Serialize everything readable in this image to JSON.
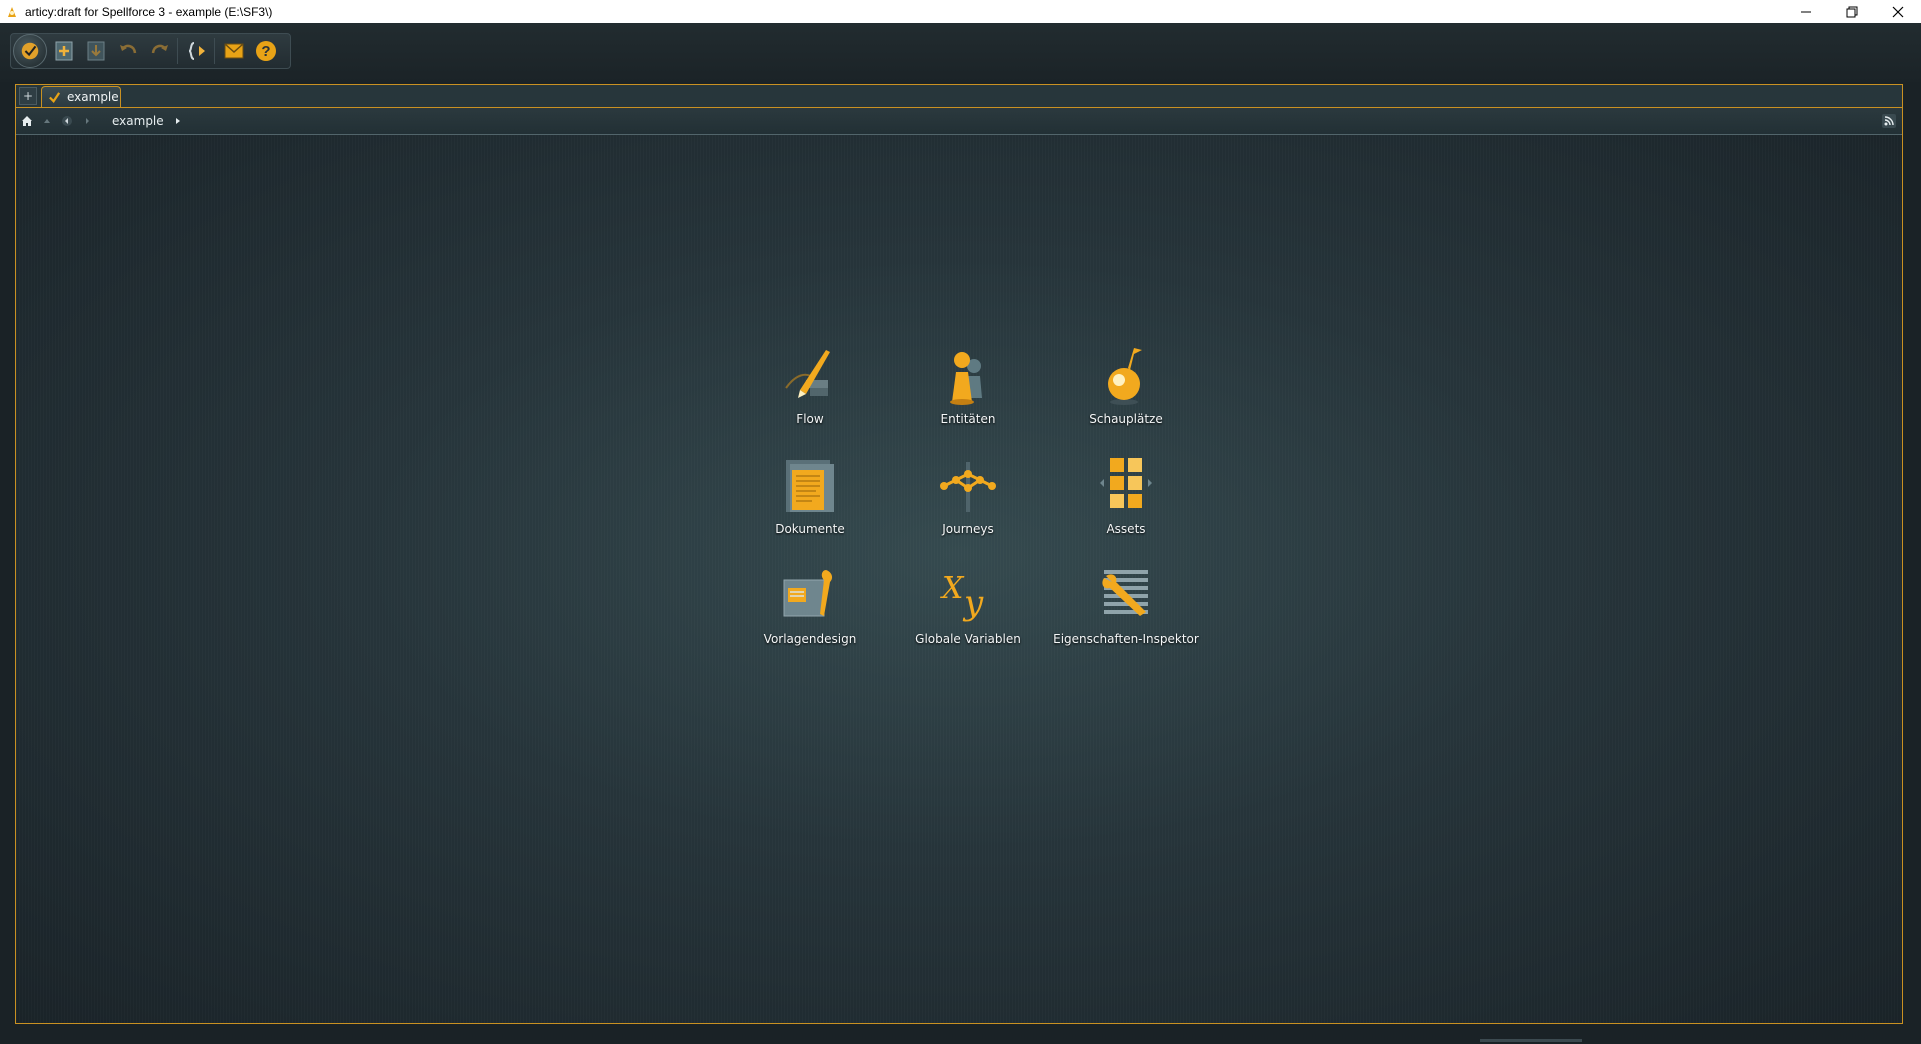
{
  "window": {
    "title": "articy:draft for Spellforce 3 - example (E:\\SF3\\)"
  },
  "toolbar": {
    "buttons": [
      "home-icon",
      "new-icon",
      "save-icon",
      "undo-icon",
      "redo-icon",
      "flow-icon",
      "mail-icon",
      "help-icon"
    ]
  },
  "tabs": {
    "add_label": "+",
    "items": [
      {
        "label": "example",
        "icon": "checkmark-icon"
      }
    ]
  },
  "navigation": {
    "breadcrumb": "example"
  },
  "dashboard": {
    "items": [
      {
        "label": "Flow",
        "icon": "flow-icon"
      },
      {
        "label": "Entitäten",
        "icon": "entities-icon"
      },
      {
        "label": "Schauplätze",
        "icon": "locations-icon"
      },
      {
        "label": "Dokumente",
        "icon": "documents-icon"
      },
      {
        "label": "Journeys",
        "icon": "journeys-icon"
      },
      {
        "label": "Assets",
        "icon": "assets-icon"
      },
      {
        "label": "Vorlagendesign",
        "icon": "template-design-icon"
      },
      {
        "label": "Globale Variablen",
        "icon": "global-variables-icon"
      },
      {
        "label": "Eigenschaften-Inspektor",
        "icon": "property-inspector-icon"
      }
    ]
  },
  "colors": {
    "accent": "#f5a623",
    "border": "#c99122",
    "background": "#26343a"
  }
}
